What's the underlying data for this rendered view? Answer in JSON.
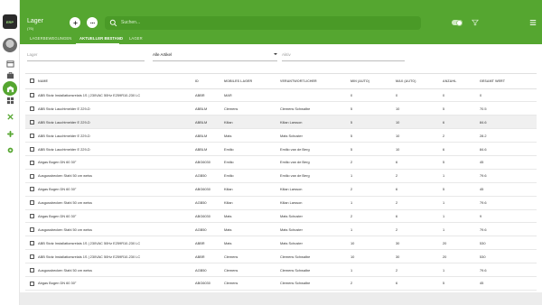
{
  "app": {
    "logo_text": "ERP",
    "title": "Lager",
    "subtitle": "(76)",
    "search_placeholder": "Suchen..."
  },
  "tabs": [
    {
      "label": "LAGERBEWEGUNGEN"
    },
    {
      "label": "AKTUELLER BESTAND"
    },
    {
      "label": "LAGER"
    }
  ],
  "filters": {
    "lager_label": "Lager",
    "artikel_selected": "Alle Artikel",
    "aktiv_label": "Aktiv"
  },
  "colors": {
    "primary": "#55a630",
    "header_dark": "#4a9a27",
    "row_highlight": "#f0f0f0"
  },
  "table": {
    "columns": [
      "NAME",
      "ID",
      "MOBILES LAGER",
      "VERANTWORTLICHER",
      "MIN (AUTO)",
      "MAX (AUTO)",
      "ANZAHL",
      "GESAMT WERT"
    ],
    "rows": [
      [
        "ABB Stotz Installationsrelais 1S | 230VAC 50Hz E259R10-230 LC",
        "ABBR",
        "MAR",
        "",
        "0",
        "0",
        "0",
        "0"
      ],
      [
        "ABB Stotz Lauchtmelder E 229-D",
        "ABBLM",
        "Clemens",
        "Clemens Schwalbe",
        "5",
        "10",
        "5",
        "70.5"
      ],
      [
        "ABB Stotz Lauchtmelder E 229-D",
        "ABBLM",
        "Kilian",
        "Kilian Larsson",
        "5",
        "10",
        "6",
        "84.6"
      ],
      [
        "ABB Stotz Lauchtmelder E 229-D",
        "ABBLM",
        "Mats",
        "Mats Schuster",
        "5",
        "10",
        "2",
        "28.2"
      ],
      [
        "ABB Stotz Lauchtmelder E 229-D",
        "ABBLM",
        "Emilio",
        "Emilio van de Berg",
        "5",
        "10",
        "6",
        "84.6"
      ],
      [
        "Abgas Bogen DN 60 30°",
        "ABG6030",
        "Emilio",
        "Emilio van de Berg",
        "2",
        "6",
        "5",
        "45"
      ],
      [
        "Ausgussbecken Stahl 50 cm weiss",
        "AGB50",
        "Emilio",
        "Emilio van de Berg",
        "1",
        "2",
        "1",
        "79.6"
      ],
      [
        "Abgas Bogen DN 60 30°",
        "ABG6030",
        "Kilian",
        "Kilian Larsson",
        "2",
        "6",
        "5",
        "45"
      ],
      [
        "Ausgussbecken Stahl 50 cm weiss",
        "AGB50",
        "Kilian",
        "Kilian Larsson",
        "1",
        "2",
        "1",
        "79.6"
      ],
      [
        "Abgas Bogen DN 60 30°",
        "ABG6030",
        "Mats",
        "Mats Schuster",
        "2",
        "6",
        "1",
        "9"
      ],
      [
        "Ausgussbecken Stahl 50 cm weiss",
        "AGB50",
        "Mats",
        "Mats Schuster",
        "1",
        "2",
        "1",
        "79.6"
      ],
      [
        "ABB Stotz Installationsrelais 1S | 230VAC 50Hz E259R10-230 LC",
        "ABBR",
        "Mats",
        "Mats Schuster",
        "10",
        "30",
        "20",
        "530"
      ],
      [
        "ABB Stotz Installationsrelais 1S | 230VAC 50Hz E259R10-230 LC",
        "ABBR",
        "Clemens",
        "Clemens Schwalbe",
        "10",
        "30",
        "20",
        "530"
      ],
      [
        "Ausgussbecken Stahl 50 cm weiss",
        "AGB50",
        "Clemens",
        "Clemens Schwalbe",
        "1",
        "2",
        "1",
        "79.6"
      ],
      [
        "Abgas Bogen DN 60 30°",
        "ABG6030",
        "Clemens",
        "Clemens Schwalbe",
        "2",
        "6",
        "5",
        "45"
      ]
    ],
    "highlighted_row": 2
  }
}
